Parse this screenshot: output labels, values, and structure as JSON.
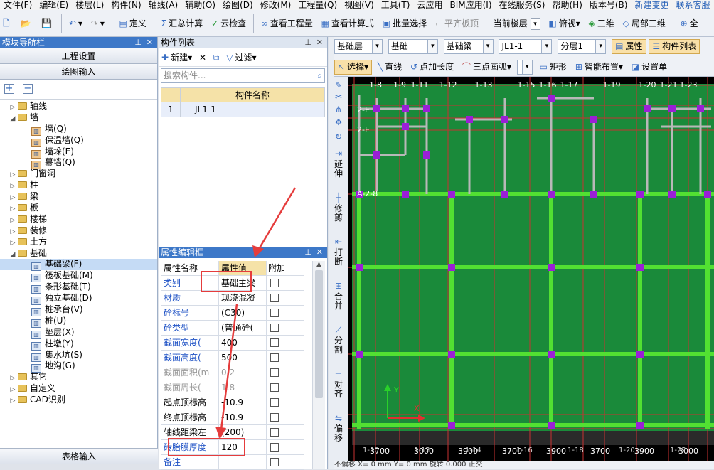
{
  "menubar": {
    "items": [
      "文件(F)",
      "编辑(E)",
      "楼层(L)",
      "构件(N)",
      "轴线(A)",
      "辅助(O)",
      "绘图(D)",
      "修改(M)",
      "工程量(Q)",
      "视图(V)",
      "工具(T)",
      "云应用",
      "BIM应用(I)",
      "在线服务(S)",
      "帮助(H)",
      "版本号(B)",
      "新建变更",
      "联系客服"
    ]
  },
  "toolbar": {
    "define": "定义",
    "sum_calc": "汇总计算",
    "cloud_check": "云检查",
    "view_quantity": "查看工程量",
    "view_formula": "查看计算式",
    "batch_select": "批量选择",
    "flat_slab": "平齐板顶",
    "current_floor": "当前楼层",
    "top_view": "俯视",
    "three_d": "三维",
    "local_3d": "局部三维",
    "full": "全"
  },
  "nav": {
    "title": "模块导航栏",
    "project_settings": "工程设置",
    "drawing_input": "绘图输入",
    "table_input": "表格输入",
    "tree": [
      {
        "label": "轴线",
        "open": false
      },
      {
        "label": "墙",
        "open": true,
        "children": [
          "墙(Q)",
          "保温墙(Q)",
          "墙垛(E)",
          "幕墙(Q)"
        ]
      },
      {
        "label": "门窗洞",
        "open": false
      },
      {
        "label": "柱",
        "open": false
      },
      {
        "label": "梁",
        "open": false
      },
      {
        "label": "板",
        "open": false
      },
      {
        "label": "楼梯",
        "open": false
      },
      {
        "label": "装修",
        "open": false
      },
      {
        "label": "土方",
        "open": false
      },
      {
        "label": "基础",
        "open": true,
        "children": [
          "基础梁(F)",
          "筏板基础(M)",
          "条形基础(T)",
          "独立基础(D)",
          "桩承台(V)",
          "桩(U)",
          "垫层(X)",
          "柱墩(Y)",
          "集水坑(S)",
          "地沟(G)"
        ]
      },
      {
        "label": "其它",
        "open": false
      },
      {
        "label": "自定义",
        "open": false
      },
      {
        "label": "CAD识别",
        "open": false
      }
    ],
    "selected": "基础梁(F)"
  },
  "component_list": {
    "title": "构件列表",
    "new_label": "新建",
    "filter_label": "过滤",
    "search_placeholder": "搜索构件...",
    "column_header": "构件名称",
    "rows": [
      {
        "index": "1",
        "name": "JL1-1"
      }
    ]
  },
  "property_editor": {
    "title": "属性编辑框",
    "headers": {
      "name": "属性名称",
      "value": "属性值",
      "extra": "附加"
    },
    "rows": [
      {
        "name": "类别",
        "value": "基础主梁",
        "style": "blue"
      },
      {
        "name": "材质",
        "value": "现浇混凝",
        "style": "blue"
      },
      {
        "name": "砼标号",
        "value": "(C30)",
        "style": "blue"
      },
      {
        "name": "砼类型",
        "value": "(普通砼(",
        "style": "blue"
      },
      {
        "name": "截面宽度(",
        "value": "400",
        "style": "blue"
      },
      {
        "name": "截面高度(",
        "value": "500",
        "style": "blue"
      },
      {
        "name": "截面面积(m",
        "value": "0.2",
        "style": "gray"
      },
      {
        "name": "截面周长(",
        "value": "1.8",
        "style": "gray"
      },
      {
        "name": "起点顶标高",
        "value": "-10.9",
        "style": "normal"
      },
      {
        "name": "终点顶标高",
        "value": "-10.9",
        "style": "normal"
      },
      {
        "name": "轴线距梁左",
        "value": "(200)",
        "style": "normal"
      },
      {
        "name": "砖胎膜厚度",
        "value": "120",
        "style": "blue"
      },
      {
        "name": "备注",
        "value": "",
        "style": "blue"
      }
    ]
  },
  "canvas_toolbar": {
    "layer": "基础层",
    "category": "基础",
    "type": "基础梁",
    "component": "JL1-1",
    "sublayer": "分层1",
    "properties": "属性",
    "component_list": "构件列表",
    "select": "选择",
    "line": "直线",
    "point_length": "点加长度",
    "arc": "三点画弧",
    "rect": "矩形",
    "smart_layout": "智能布置",
    "set_ratio": "设置单"
  },
  "side_tools": [
    "延伸",
    "修剪",
    "打断",
    "合并",
    "分割",
    "对齐",
    "偏移"
  ],
  "axes": {
    "top_labels": [
      "1-8",
      "1-9",
      "1-11",
      "1-12",
      "1-13",
      "1-15",
      "1-16",
      "1-17",
      "1-19",
      "1-20",
      "1-21",
      "1-23"
    ],
    "left_labels": [
      "2-E",
      "2-E",
      "A-2-8"
    ],
    "bottom_dims": [
      "3700",
      "3000",
      "3900",
      "3700",
      "3900",
      "3700",
      "3900",
      "3000"
    ],
    "bottom_labels": [
      "1-10",
      "1-12",
      "1-14",
      "1-16",
      "1-18",
      "1-20",
      "1-22"
    ]
  },
  "statusbar": {
    "text": "不偏移  X=  0  mm Y=  0  mm  旋转  0.000  正交"
  },
  "colors": {
    "panel_title": "#3d78c8",
    "canvas_green": "#1a8a3a",
    "beam_bright": "#52e032",
    "node_purple": "#9a1fd6",
    "axis_red": "#c83232",
    "highlight": "#e53c3c"
  }
}
